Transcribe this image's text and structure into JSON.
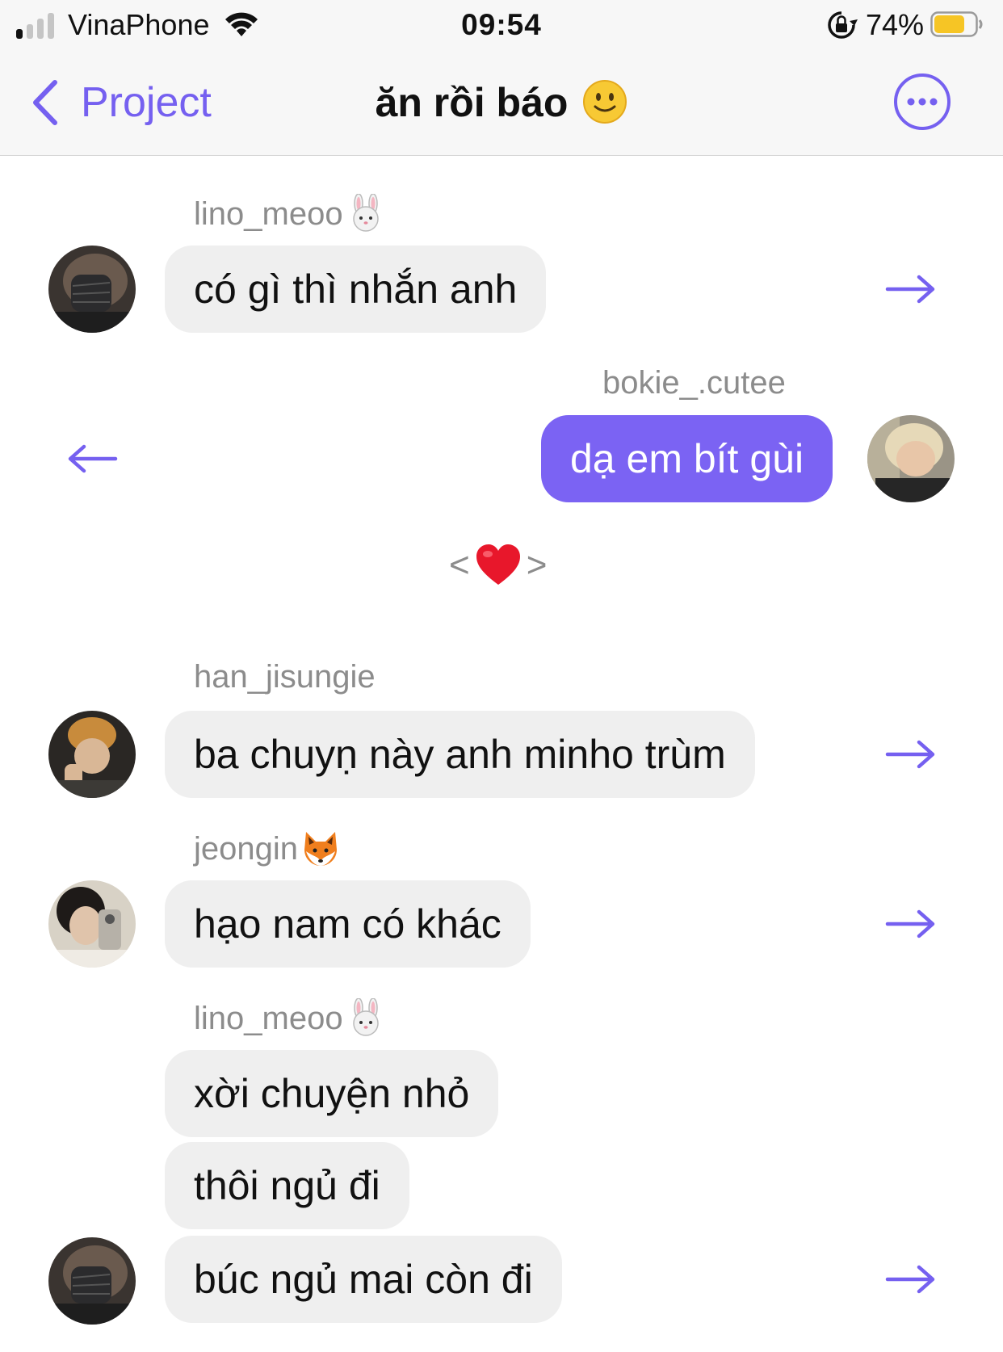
{
  "status_bar": {
    "carrier": "VinaPhone",
    "time": "09:54",
    "battery_percent": "74%",
    "battery_level": 0.74,
    "signal_bars_active": 1
  },
  "nav": {
    "back_label": "Project",
    "title": "ăn rồi báo",
    "title_emoji": "slightly-smiling-face",
    "more_icon": "more-horizontal-icon"
  },
  "accent_color": "#7b63f3",
  "messages": [
    {
      "sender": "lino_meoo",
      "sender_emoji": "rabbit-face",
      "text": "có gì thì nhắn anh",
      "mine": false
    },
    {
      "sender": "bokie_.cutee",
      "text": "dạ em bít gùi",
      "mine": true
    },
    {
      "sender": "han_jisungie",
      "text": "ba chuyn này anh minho trùm",
      "mine": false
    },
    {
      "sender": "jeongin",
      "sender_emoji": "fox-face",
      "text": "hạo nam có khác",
      "mine": false
    },
    {
      "sender": "lino_meoo",
      "sender_emoji": "rabbit-face",
      "text": "xời chuyện nhỏ",
      "mine": false
    },
    {
      "text": "thôi ngủ đi",
      "mine": false
    },
    {
      "text": "búc ngủ mai còn đi",
      "mine": false
    }
  ],
  "reaction": {
    "left": "<",
    "right": ">",
    "emoji": "red-heart"
  },
  "display": {
    "msg2_text": "ba chuyṇ này anh minho trùm"
  }
}
